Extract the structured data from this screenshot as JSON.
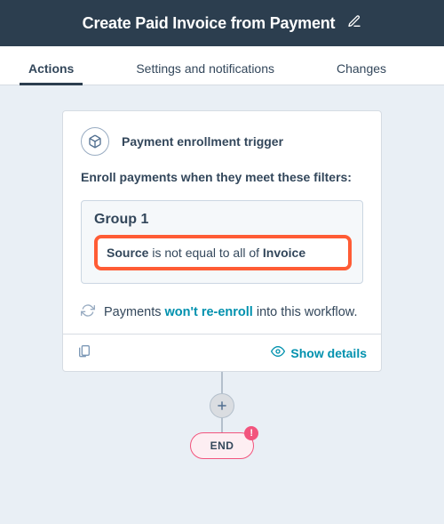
{
  "header": {
    "title": "Create Paid Invoice from Payment"
  },
  "tabs": [
    {
      "id": "actions",
      "label": "Actions",
      "active": true
    },
    {
      "id": "settings",
      "label": "Settings and notifications",
      "active": false
    },
    {
      "id": "changes",
      "label": "Changes",
      "active": false
    }
  ],
  "trigger": {
    "title": "Payment enrollment trigger",
    "description": "Enroll payments when they meet these filters:",
    "group": {
      "title": "Group 1",
      "rule": {
        "field": "Source",
        "operator": "is not equal to all of",
        "value": "Invoice"
      }
    },
    "reenroll": {
      "prefix": "Payments",
      "link": "won't re-enroll",
      "suffix": "into this workflow."
    },
    "footer": {
      "show_details": "Show details"
    }
  },
  "nodes": {
    "end_label": "END",
    "end_alert": "!"
  }
}
